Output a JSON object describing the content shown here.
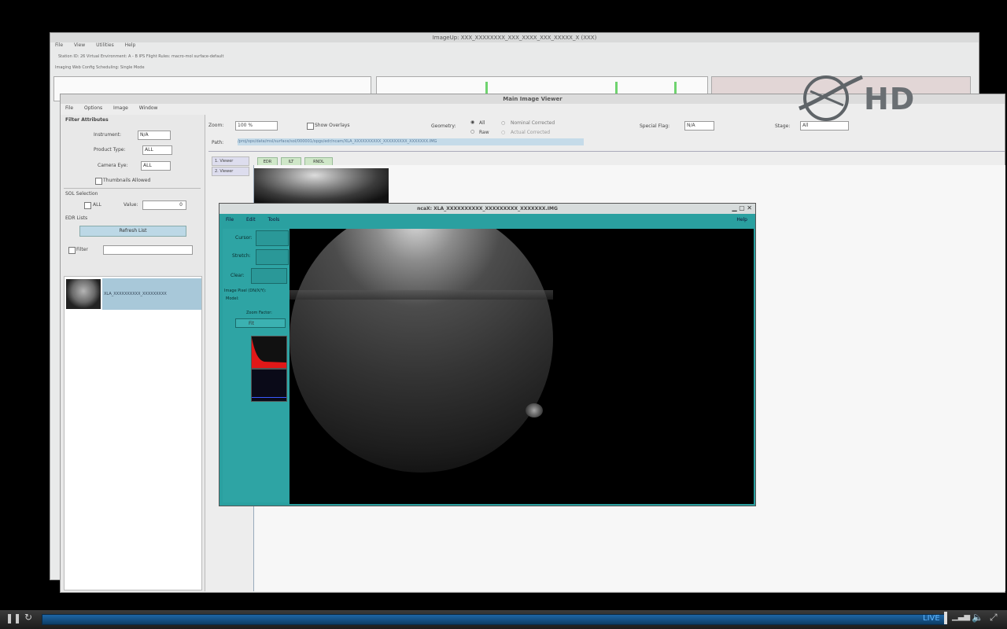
{
  "back_window": {
    "title": "ImageUp: XXX_XXXXXXXX_XXX_XXXX_XXX_XXXXX_X (XXX)",
    "menu": [
      "File",
      "View",
      "Utilities",
      "Help"
    ],
    "info_line": "Station ID: 26          Virtual Environment: A - B          IPS Flight Rules: macro-mol surface-default",
    "mode_label": "Imaging Web Config        Scheduling: Single Mode"
  },
  "main_window": {
    "title": "Main Image Viewer",
    "menu": [
      "File",
      "Options",
      "Image",
      "Window"
    ],
    "filter_attributes": "Filter Attributes",
    "instrument_label": "Instrument:",
    "instrument_value": "N/A",
    "product_type_label": "Product Type:",
    "product_type_value": "ALL",
    "camera_eye_label": "Camera Eye:",
    "camera_eye_value": "ALL",
    "thumbnails_allowed": "Thumbnails Allowed",
    "sol_selection": "SOL Selection",
    "sol_all_label": "ALL",
    "sol_value_label": "Value:",
    "sol_value": "0",
    "edr_lists": "EDR Lists",
    "refresh_button": "Refresh List",
    "filter_checkbox": "Filter",
    "list_item_label": "XLA_XXXXXXXXXX_XXXXXXXXX",
    "zoom_label": "Zoom:",
    "zoom_value": "100 %",
    "show_overlays": "Show Overlays",
    "geometry_label": "Geometry:",
    "geometry_all": "All",
    "geometry_raw": "Raw",
    "nominal_corrected": "Nominal Corrected",
    "actual_corrected": "Actual Corrected",
    "special_flag_label": "Special Flag:",
    "special_flag_value": "N/A",
    "stage_label": "Stage:",
    "stage_value": "All",
    "path_label": "Path:",
    "path_value": "/proj/ops/data/msl/surface/sol/000001/opgs/edr/ncam/XLA_XXXXXXXXXX_XXXXXXXXX_XXXXXXX.IMG",
    "side_tabs": [
      "1. Viewer",
      "2. Viewer"
    ],
    "top_tabs": [
      "EDR",
      "ILT",
      "RNDL"
    ]
  },
  "sub_window": {
    "title": "ncaX: XLA_XXXXXXXXXX_XXXXXXXXX_XXXXXXX.IMG",
    "menu": [
      "File",
      "Edit",
      "Tools"
    ],
    "help": "Help",
    "cursor_label": "Cursor:",
    "stretch_label": "Stretch:",
    "clear_label": "Clear:",
    "image_pixel_label": "Image Pixel (DN/X/Y):",
    "model_label": "Model:",
    "zoom_factor_label": "Zoom Factor:",
    "zoom_factor_value": "Fit"
  },
  "player": {
    "live_label": "LIVE",
    "hd_label": "HD"
  },
  "colors": {
    "teal": "#2aa0a0",
    "progress_blue": "#1f66a6",
    "live_blue": "#5fb6ff"
  }
}
